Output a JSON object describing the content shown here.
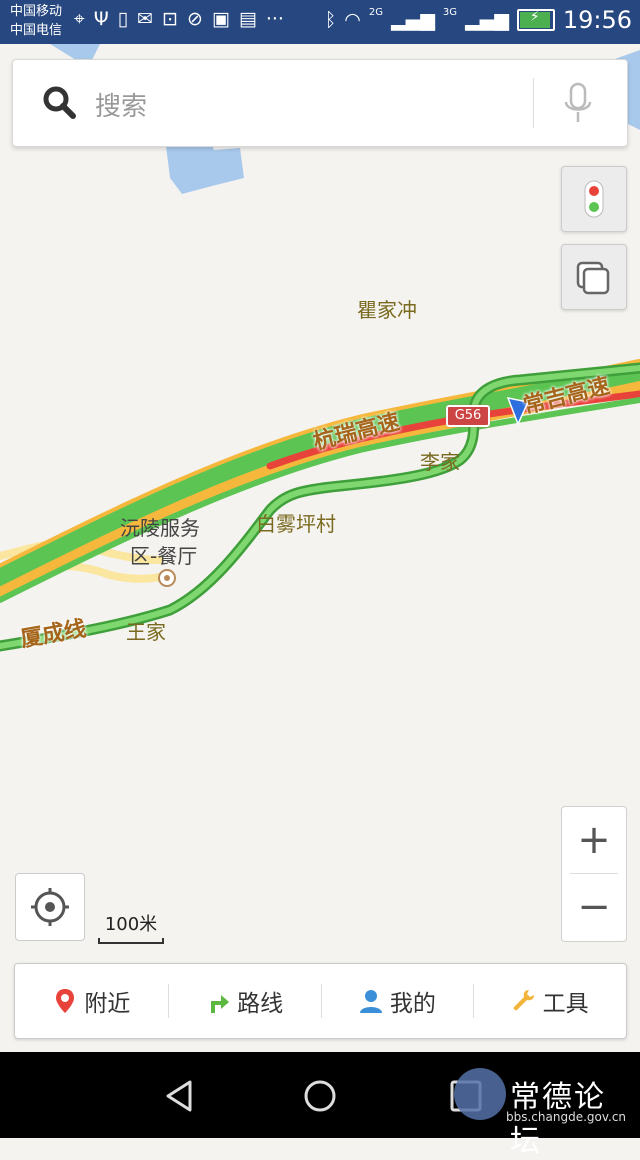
{
  "status_bar": {
    "carrier_1": "中国移动",
    "carrier_2": "中国电信",
    "net_1": "2G",
    "net_2": "3G",
    "time": "19:56"
  },
  "search": {
    "placeholder": "搜索"
  },
  "map": {
    "labels": {
      "qujiachong": "瞿家冲",
      "lijia": "李家",
      "baiwupingcun": "白雾坪村",
      "service_area": "沅陵服务区-餐厅",
      "service_area_line1": "沅陵服务",
      "service_area_line2": "区-餐厅",
      "wangjia": "王家"
    },
    "roads": {
      "hangrui": "杭瑞高速",
      "changji": "常吉高速",
      "xiacheng": "厦成线",
      "shield": "G56"
    },
    "scale": "100米",
    "colors": {
      "road_green": "#5cc452",
      "road_red": "#e8433a",
      "road_orange": "#f5b83c",
      "water": "#a9c9ec",
      "minor_road": "#fbe6a0"
    }
  },
  "controls": {
    "traffic_icon": "traffic-light-icon",
    "layers_icon": "layers-icon",
    "zoom_in": "+",
    "zoom_out": "−",
    "locate_icon": "locate-icon"
  },
  "bottom_nav": [
    {
      "label": "附近",
      "icon": "location-pin-icon"
    },
    {
      "label": "路线",
      "icon": "route-arrow-icon"
    },
    {
      "label": "我的",
      "icon": "user-icon"
    },
    {
      "label": "工具",
      "icon": "wrench-icon"
    }
  ],
  "watermark": {
    "name": "常德论坛",
    "url": "bbs.changde.gov.cn"
  }
}
